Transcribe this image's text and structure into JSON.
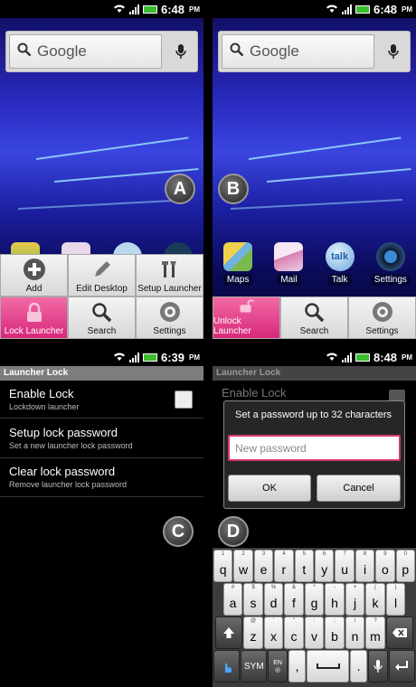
{
  "panels": {
    "a": {
      "time": "6:48",
      "ampm": "PM",
      "badge": "A",
      "search_placeholder": "Google",
      "menu": [
        {
          "label": "Add",
          "icon": "plus-icon"
        },
        {
          "label": "Edit Desktop",
          "icon": "pencil-icon"
        },
        {
          "label": "Setup Launcher",
          "icon": "tools-icon"
        },
        {
          "label": "Lock Launcher",
          "icon": "lock-icon"
        },
        {
          "label": "Search",
          "icon": "search-icon"
        },
        {
          "label": "Settings",
          "icon": "gear-icon"
        }
      ]
    },
    "b": {
      "time": "6:48",
      "ampm": "PM",
      "badge": "B",
      "search_placeholder": "Google",
      "apps": [
        {
          "label": "Maps",
          "icon": "maps-icon"
        },
        {
          "label": "Mail",
          "icon": "mail-icon"
        },
        {
          "label": "Talk",
          "icon": "talk-icon"
        },
        {
          "label": "Settings",
          "icon": "settings-icon"
        }
      ],
      "menu": [
        {
          "label": "Unlock Launcher",
          "icon": "unlock-icon"
        },
        {
          "label": "Search",
          "icon": "search-icon"
        },
        {
          "label": "Settings",
          "icon": "gear-icon"
        }
      ]
    },
    "c": {
      "time": "6:39",
      "ampm": "PM",
      "badge": "C",
      "title": "Launcher Lock",
      "prefs": [
        {
          "title": "Enable Lock",
          "summary": "Lockdown launcher"
        },
        {
          "title": "Setup lock password",
          "summary": "Set a new launcher lock password"
        },
        {
          "title": "Clear lock password",
          "summary": "Remove launcher lock password"
        }
      ]
    },
    "d": {
      "time": "8:48",
      "ampm": "PM",
      "badge": "D",
      "title": "Launcher Lock",
      "enable_lock": "Enable Lock",
      "dialog": {
        "message": "Set a password up to 32 characters",
        "placeholder": "New password",
        "ok": "OK",
        "cancel": "Cancel"
      },
      "keyboard": {
        "row1": [
          [
            "q",
            "1"
          ],
          [
            "w",
            "2"
          ],
          [
            "e",
            "3"
          ],
          [
            "r",
            "4"
          ],
          [
            "t",
            "5"
          ],
          [
            "y",
            "6"
          ],
          [
            "u",
            "7"
          ],
          [
            "i",
            "8"
          ],
          [
            "o",
            "9"
          ],
          [
            "p",
            "0"
          ]
        ],
        "row2": [
          [
            "a",
            "#"
          ],
          [
            "s",
            "$"
          ],
          [
            "d",
            "%"
          ],
          [
            "f",
            "&"
          ],
          [
            "g",
            "*"
          ],
          [
            "h",
            "-"
          ],
          [
            "j",
            "+"
          ],
          [
            "k",
            "("
          ],
          [
            "l",
            ")"
          ]
        ],
        "row3": [
          [
            "z",
            "@"
          ],
          [
            "x",
            "'"
          ],
          [
            "c",
            "\""
          ],
          [
            "v",
            ":"
          ],
          [
            "b",
            ";"
          ],
          [
            "n",
            "/"
          ],
          [
            "m",
            "?"
          ]
        ],
        "sym": "SYM",
        "lang": "EN",
        "comma": ",",
        "period": "."
      }
    }
  }
}
